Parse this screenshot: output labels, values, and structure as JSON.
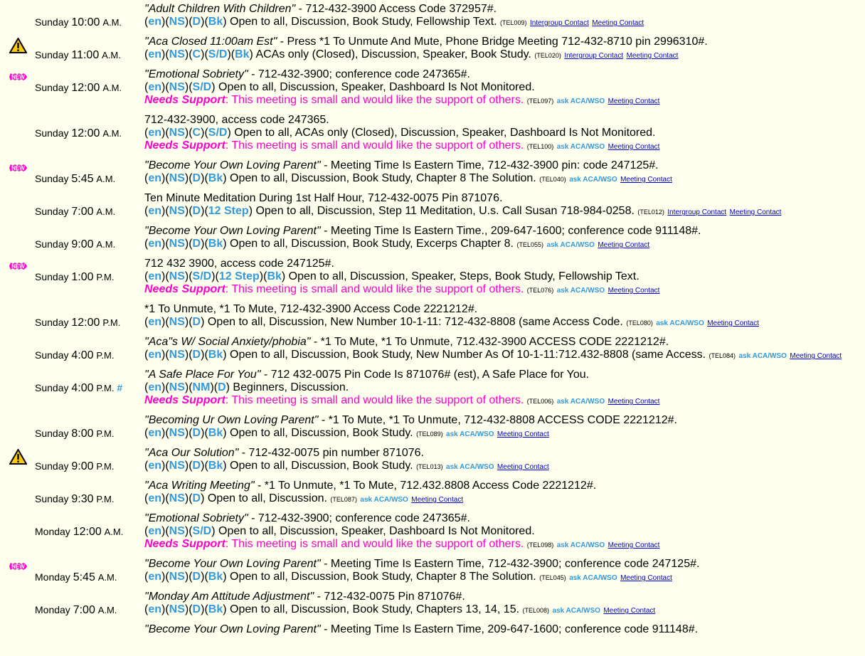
{
  "labels": {
    "needs_support": "Needs Support",
    "ask": "ask ACA/WSO",
    "contact": "Meeting Contact",
    "intergroup": "Intergroup Contact",
    "support_msg": ": This meeting is small and would like the support of others.",
    "hash": "#"
  },
  "meetings": [
    {
      "day": "Sunday",
      "time": "10:00",
      "ampm": "A.M.",
      "badge": "",
      "title": "Adult Children With Children",
      "line1": " - 712-432-3900 Access Code 372957#.",
      "codes": [
        "en",
        "NS",
        "D",
        "Bk"
      ],
      "desc": " Open to all, Discussion, Book Study, Fellowship Text.",
      "tel": "(TEL009)",
      "ask": false,
      "intergroup": true,
      "needs": false,
      "hash": false
    },
    {
      "day": "Sunday",
      "time": "11:00",
      "ampm": "A.M.",
      "badge": "warn",
      "title": "Aca Closed 11:00am Est",
      "line1": " - Press *1 To Unmute And Mute, Phone Bridge Meeting 712-432-8710 pin 2996310#.",
      "codes": [
        "en",
        "NS",
        "C",
        "S/D",
        "Bk"
      ],
      "desc": " ACAs only (Closed), Discussion, Speaker, Book Study.",
      "tel": "(TEL020)",
      "ask": false,
      "intergroup": true,
      "needs": false,
      "hash": false
    },
    {
      "day": "Sunday",
      "time": "12:00",
      "ampm": "A.M.",
      "badge": "new",
      "title": "Emotional Sobriety",
      "line1": " - 712-432-3900; conference code 247365#.",
      "codes": [
        "en",
        "NS",
        "S/D"
      ],
      "desc": " Open to all, Discussion, Speaker, Dashboard Is Not Monitored.",
      "tel": "(TEL097)",
      "ask": true,
      "intergroup": false,
      "needs": true,
      "hash": false
    },
    {
      "day": "Sunday",
      "time": "12:00",
      "ampm": "A.M.",
      "badge": "",
      "title": "",
      "line1": "712-432-3900, access code 247365.",
      "codes": [
        "en",
        "NS",
        "C",
        "S/D"
      ],
      "desc": " Open to all, ACAs only (Closed), Discussion, Speaker, Dashboard Is Not Monitored.",
      "tel": "(TEL100)",
      "ask": true,
      "intergroup": false,
      "needs": true,
      "hash": false
    },
    {
      "day": "Sunday",
      "time": "5:45",
      "ampm": "A.M.",
      "badge": "new",
      "title": "Become Your Own Loving Parent",
      "line1": " - Meeting Time Is Eastern Time, 712-432-3900 pin: code 247125#.",
      "codes": [
        "en",
        "NS",
        "D",
        "Bk"
      ],
      "desc": " Open to all, Discussion, Book Study, Chapter 8 The Solution.",
      "tel": "(TEL040)",
      "ask": true,
      "intergroup": false,
      "needs": false,
      "hash": false
    },
    {
      "day": "Sunday",
      "time": "7:00",
      "ampm": "A.M.",
      "badge": "",
      "title": "",
      "line1": "Ten Minute Meditation During 1st Half Hour, 712-432-0075 Pin 871076.",
      "codes": [
        "en",
        "NS",
        "D",
        "12 Step"
      ],
      "desc": " Open to all, Discussion, Step 11 Meditation, U.s. Call Susan 718-984-0258.",
      "tel": "(TEL012)",
      "ask": false,
      "intergroup": true,
      "needs": false,
      "hash": false
    },
    {
      "day": "Sunday",
      "time": "9:00",
      "ampm": "A.M.",
      "badge": "",
      "title": "Become Your Own Loving Parent",
      "line1": " - Meeting Time Is Eastern Time., 209-647-1600; conference code 911148#.",
      "codes": [
        "en",
        "NS",
        "D",
        "Bk"
      ],
      "desc": " Open to all, Discussion, Book Study, Excerps Chapter 8.",
      "tel": "(TEL055)",
      "ask": true,
      "intergroup": false,
      "needs": false,
      "hash": false
    },
    {
      "day": "Sunday",
      "time": "1:00",
      "ampm": "P.M.",
      "badge": "new",
      "title": "",
      "line1": "712 432 3900, access code 247125#.",
      "codes": [
        "en",
        "NS",
        "S/D",
        "12 Step",
        "Bk"
      ],
      "desc": " Open to all, Discussion, Speaker, Steps, Book Study, Fellowship Text.",
      "tel": "(TEL076)",
      "ask": true,
      "intergroup": false,
      "needs": true,
      "hash": false
    },
    {
      "day": "Sunday",
      "time": "12:00",
      "ampm": "P.M.",
      "badge": "",
      "title": "",
      "line1": "*1 To Unmute, *1 To Mute, 712-432-3900 Access Code 2221212#.",
      "codes": [
        "en",
        "NS",
        "D"
      ],
      "desc": " Open to all, Discussion, New Number 10-1-11: 712-432-8808 (same Access Code.",
      "tel": "(TEL080)",
      "ask": true,
      "intergroup": false,
      "needs": false,
      "hash": false
    },
    {
      "day": "Sunday",
      "time": "4:00",
      "ampm": "P.M.",
      "badge": "",
      "title": "Aca\"s W/ Social Anxiety/phobia",
      "line1": " - *1 To Mute, *1 To Unmute, 712.432-3900 ACCESS CODE 2221212#.",
      "codes": [
        "en",
        "NS",
        "D",
        "Bk"
      ],
      "desc": " Open to all, Discussion, Book Study, New Number As Of 10-1-11:712.432-8808 (same Access.",
      "tel": "(TEL084)",
      "ask": true,
      "intergroup": false,
      "needs": false,
      "hash": false
    },
    {
      "day": "Sunday",
      "time": "4:00",
      "ampm": "P.M.",
      "badge": "",
      "title": "A Safe Place For You",
      "line1": " - 712 432-0075 Pin Code Is 871076# (est), A Safe Place for You.",
      "codes": [
        "en",
        "NS",
        "NM",
        "D"
      ],
      "desc": " Beginners, Discussion.",
      "tel": "(TEL006)",
      "ask": true,
      "intergroup": false,
      "needs": true,
      "hash": true
    },
    {
      "day": "Sunday",
      "time": "8:00",
      "ampm": "P.M.",
      "badge": "",
      "title": "Becoming Ur Own Loving Parent",
      "line1": " - *1 To Mute, *1 To Unmute, 712-432-8808 ACCESS CODE 2221212#.",
      "codes": [
        "en",
        "NS",
        "D",
        "Bk"
      ],
      "desc": " Open to all, Discussion, Book Study.",
      "tel": "(TEL089)",
      "ask": true,
      "intergroup": false,
      "needs": false,
      "hash": false
    },
    {
      "day": "Sunday",
      "time": "9:00",
      "ampm": "P.M.",
      "badge": "warn",
      "title": "Aca Our Solution",
      "line1": " - 712-432-0075 pin number 871076.",
      "codes": [
        "en",
        "NS",
        "D",
        "Bk"
      ],
      "desc": " Open to all, Discussion, Book Study.",
      "tel": "(TEL013)",
      "ask": true,
      "intergroup": false,
      "needs": false,
      "hash": false
    },
    {
      "day": "Sunday",
      "time": "9:30",
      "ampm": "P.M.",
      "badge": "",
      "title": "Aca Writing Meeting",
      "line1": " - *1 To Unmute, *1 To Mute, 712.432.8808 Access Code 2221212#.",
      "codes": [
        "en",
        "NS",
        "D"
      ],
      "desc": " Open to all, Discussion.",
      "tel": "(TEL087)",
      "ask": true,
      "intergroup": false,
      "needs": false,
      "hash": false
    },
    {
      "day": "Monday",
      "time": "12:00",
      "ampm": "A.M.",
      "badge": "",
      "title": "Emotional Sobriety",
      "line1": " - 712-432-3900; conference code 247365#.",
      "codes": [
        "en",
        "NS",
        "S/D"
      ],
      "desc": " Open to all, Discussion, Speaker, Dashboard Is Not Monitored.",
      "tel": "(TEL098)",
      "ask": true,
      "intergroup": false,
      "needs": true,
      "hash": false
    },
    {
      "day": "Monday",
      "time": "5:45",
      "ampm": "A.M.",
      "badge": "new",
      "title": "Become Your Own Loving Parent",
      "line1": " - Meeting Time Is Eastern Time, 712-432-3900; conference code 247125#.",
      "codes": [
        "en",
        "NS",
        "D",
        "Bk"
      ],
      "desc": " Open to all, Discussion, Book Study, Chapter 8 The Solution.",
      "tel": "(TEL045)",
      "ask": true,
      "intergroup": false,
      "needs": false,
      "hash": false
    },
    {
      "day": "Monday",
      "time": "7:00",
      "ampm": "A.M.",
      "badge": "",
      "title": "Monday Am Attitude Adjustment",
      "line1": " - 712-432-0075 Pin 871076#.",
      "codes": [
        "en",
        "NS",
        "D",
        "Bk"
      ],
      "desc": " Open to all, Discussion, Book Study, Chapters 13, 14, 15.",
      "tel": "(TEL008)",
      "ask": true,
      "intergroup": false,
      "needs": false,
      "hash": false
    },
    {
      "day": "",
      "time": "",
      "ampm": "",
      "badge": "",
      "title": "Become Your Own Loving Parent",
      "line1": " - Meeting Time Is Eastern Time, 209-647-1600; conference code 911148#.",
      "codes": [],
      "desc": "",
      "tel": "",
      "ask": false,
      "intergroup": false,
      "needs": false,
      "hash": false
    }
  ]
}
